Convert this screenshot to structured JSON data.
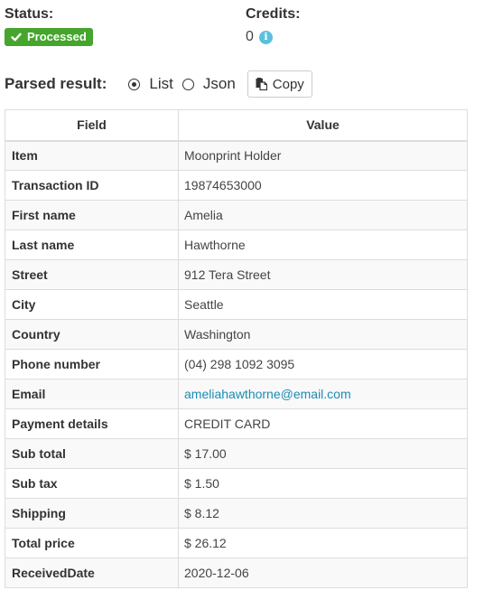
{
  "status": {
    "label": "Status:",
    "badge_text": "Processed",
    "badge_icon": "check-icon",
    "badge_color": "#45a52d"
  },
  "credits": {
    "label": "Credits:",
    "value": "0",
    "info_icon": "info-icon",
    "info_color": "#5bc0de"
  },
  "parsed_result": {
    "label": "Parsed result:",
    "options": [
      {
        "label": "List",
        "selected": true
      },
      {
        "label": "Json",
        "selected": false
      }
    ],
    "copy_label": "Copy",
    "copy_icon": "clipboard-icon"
  },
  "table": {
    "headers": [
      "Field",
      "Value"
    ],
    "rows": [
      {
        "field": "Item",
        "value": "Moonprint Holder"
      },
      {
        "field": "Transaction ID",
        "value": "19874653000"
      },
      {
        "field": "First name",
        "value": "Amelia"
      },
      {
        "field": "Last name",
        "value": "Hawthorne"
      },
      {
        "field": "Street",
        "value": "912 Tera Street"
      },
      {
        "field": "City",
        "value": "Seattle"
      },
      {
        "field": "Country",
        "value": "Washington"
      },
      {
        "field": "Phone number",
        "value": "(04) 298 1092 3095"
      },
      {
        "field": "Email",
        "value": "ameliahawthorne@email.com",
        "link": true
      },
      {
        "field": "Payment details",
        "value": "CREDIT CARD"
      },
      {
        "field": "Sub total",
        "value": "$ 17.00"
      },
      {
        "field": "Sub tax",
        "value": "$ 1.50"
      },
      {
        "field": "Shipping",
        "value": "$ 8.12"
      },
      {
        "field": "Total price",
        "value": "$ 26.12"
      },
      {
        "field": "ReceivedDate",
        "value": "2020-12-06"
      }
    ]
  },
  "colors": {
    "link": "#1a8bb5",
    "stripe": "#f9f9f9",
    "border": "#dddddd"
  }
}
